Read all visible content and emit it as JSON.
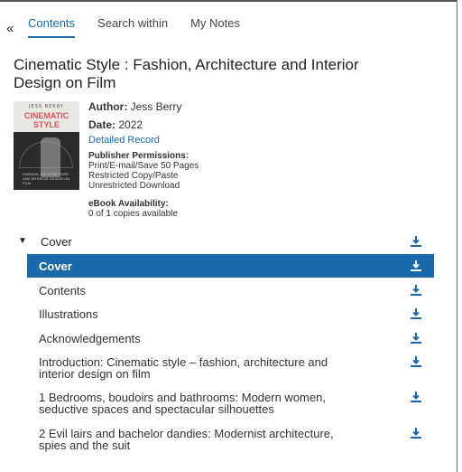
{
  "tabs": [
    {
      "label": "Contents",
      "active": true
    },
    {
      "label": "Search within",
      "active": false
    },
    {
      "label": "My Notes",
      "active": false
    }
  ],
  "collapse_glyph": "«",
  "book": {
    "title": "Cinematic Style : Fashion, Architecture and Interior Design on Film",
    "cover": {
      "author_line": "JESS BERRY",
      "title_line1": "CINEMATIC",
      "title_line2": "STYLE",
      "subtitle": "FASHION, ARCHITECTURE AND INTERIOR DESIGN ON FILM"
    },
    "author_label": "Author:",
    "author": "Jess Berry",
    "date_label": "Date:",
    "date": "2022",
    "detailed_record": "Detailed Record",
    "permissions_label": "Publisher Permissions:",
    "permissions": [
      "Print/E-mail/Save 50 Pages",
      "Restricted Copy/Paste",
      "Unrestricted Download"
    ],
    "availability_label": "eBook Availability:",
    "availability": "0 of 1 copies available"
  },
  "toc": {
    "section_label": "Cover",
    "items": [
      {
        "label": "Cover",
        "selected": true
      },
      {
        "label": "Contents",
        "selected": false
      },
      {
        "label": "Illustrations",
        "selected": false
      },
      {
        "label": "Acknowledgements",
        "selected": false
      },
      {
        "label": "Introduction: Cinematic style – fashion, architecture and interior design on film",
        "selected": false
      },
      {
        "label": "1 Bedrooms, boudoirs and bathrooms: Modern women, seductive spaces and spectacular silhouettes",
        "selected": false
      },
      {
        "label": "2 Evil lairs and bachelor dandies: Modernist architecture, spies and the suit",
        "selected": false
      }
    ]
  },
  "colors": {
    "accent": "#1a6aab",
    "selected_bg": "#1a6aab",
    "selected_text": "#ffffff"
  },
  "icons": {
    "download": "download-icon",
    "collapse": "double-chevron-left-icon",
    "caret": "caret-down-icon"
  }
}
